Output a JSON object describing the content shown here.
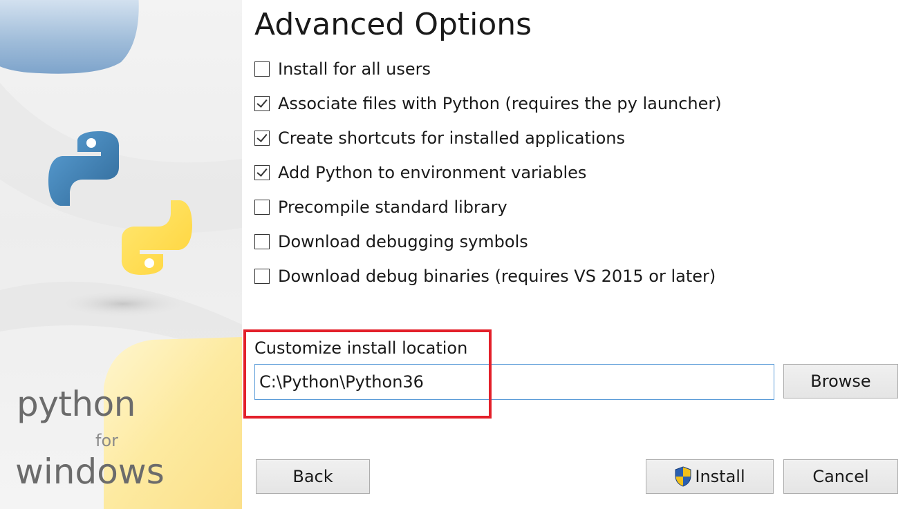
{
  "title": "Advanced Options",
  "brand": {
    "line1": "python",
    "line2": "for",
    "line3": "windows"
  },
  "options": [
    {
      "label": "Install for all users",
      "checked": false
    },
    {
      "label": "Associate files with Python (requires the py launcher)",
      "checked": true
    },
    {
      "label": "Create shortcuts for installed applications",
      "checked": true
    },
    {
      "label": "Add Python to environment variables",
      "checked": true
    },
    {
      "label": "Precompile standard library",
      "checked": false
    },
    {
      "label": "Download debugging symbols",
      "checked": false
    },
    {
      "label": "Download debug binaries (requires VS 2015 or later)",
      "checked": false
    }
  ],
  "install_location": {
    "label": "Customize install location",
    "value": "C:\\Python\\Python36"
  },
  "buttons": {
    "browse": "Browse",
    "back": "Back",
    "install": "Install",
    "cancel": "Cancel"
  },
  "colors": {
    "highlight": "#e3202a",
    "input_border": "#5a9bd8",
    "python_blue": "#3a6ea5",
    "python_yellow": "#f7c93e"
  },
  "icons": {
    "logo": "python-logo-icon",
    "shield": "uac-shield-icon"
  }
}
